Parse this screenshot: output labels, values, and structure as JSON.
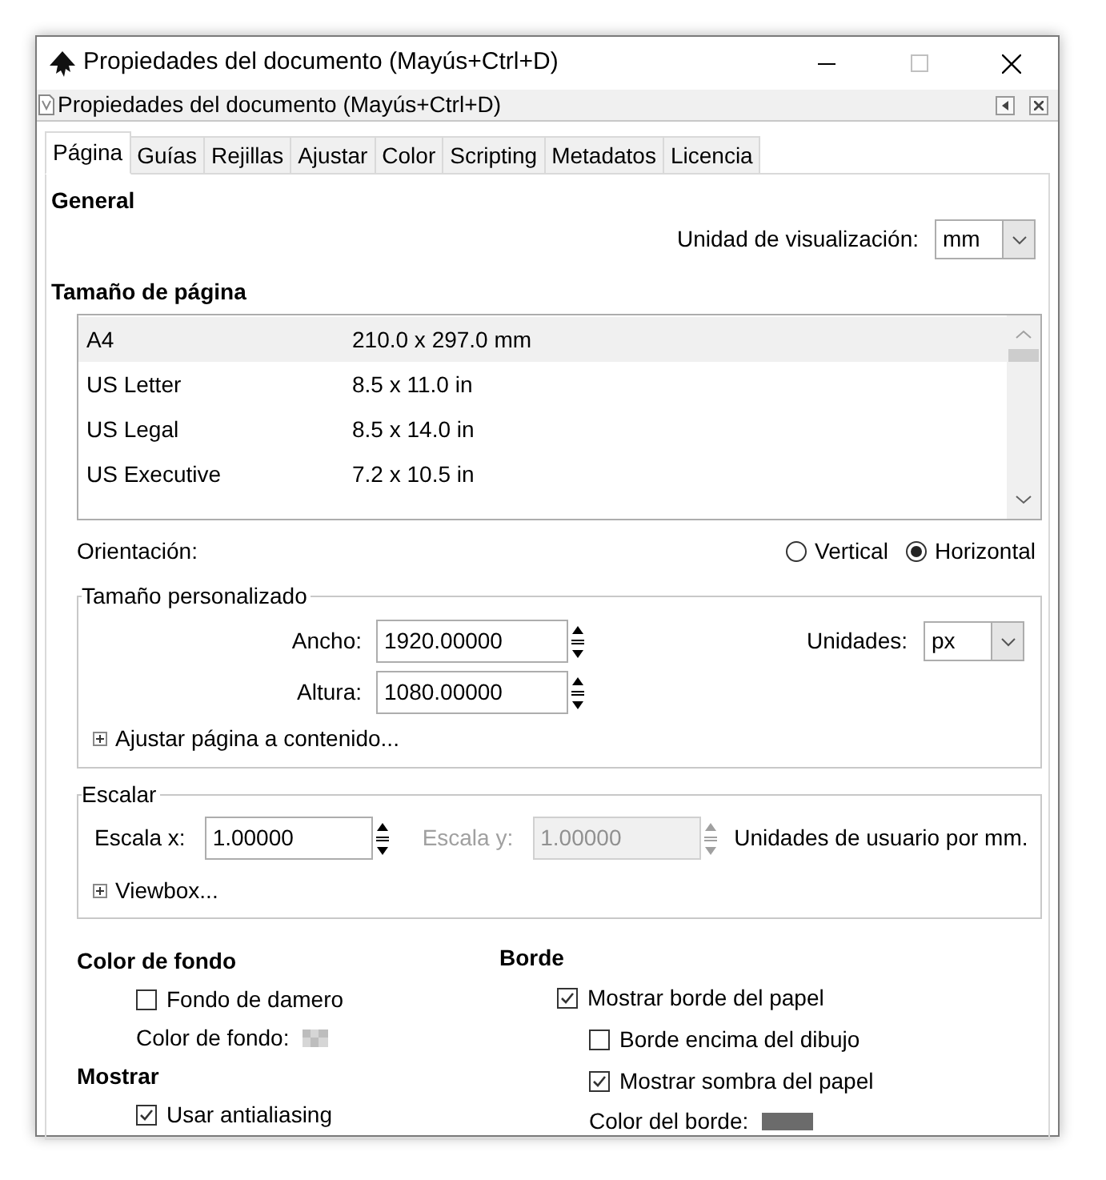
{
  "window": {
    "title": "Propiedades del documento (Mayús+Ctrl+D)"
  },
  "panel": {
    "title": "Propiedades del documento (Mayús+Ctrl+D)"
  },
  "tabs": [
    {
      "label": "Página",
      "selected": true
    },
    {
      "label": "Guías",
      "selected": false
    },
    {
      "label": "Rejillas",
      "selected": false
    },
    {
      "label": "Ajustar",
      "selected": false
    },
    {
      "label": "Color",
      "selected": false
    },
    {
      "label": "Scripting",
      "selected": false
    },
    {
      "label": "Metadatos",
      "selected": false
    },
    {
      "label": "Licencia",
      "selected": false
    }
  ],
  "general": {
    "heading": "General",
    "display_unit": {
      "label": "Unidad de visualización:",
      "value": "mm"
    }
  },
  "page_size": {
    "heading": "Tamaño de página",
    "rows": [
      {
        "name": "A4",
        "size": "210.0 x 297.0 mm",
        "selected": true
      },
      {
        "name": "US Letter",
        "size": "8.5 x 11.0 in",
        "selected": false
      },
      {
        "name": "US Legal",
        "size": "8.5 x 14.0 in",
        "selected": false
      },
      {
        "name": "US Executive",
        "size": "7.2 x 10.5 in",
        "selected": false
      }
    ]
  },
  "orientation": {
    "label": "Orientación:",
    "options": [
      {
        "label": "Vertical",
        "selected": false
      },
      {
        "label": "Horizontal",
        "selected": true
      }
    ]
  },
  "custom_size": {
    "legend": "Tamaño personalizado",
    "width": {
      "label": "Ancho:",
      "value": "1920.00000"
    },
    "height": {
      "label": "Altura:",
      "value": "1080.00000"
    },
    "units": {
      "label": "Unidades:",
      "value": "px"
    },
    "expander": {
      "label": "Ajustar página a contenido...",
      "expanded": false
    }
  },
  "scale": {
    "legend": "Escalar",
    "scale_x": {
      "label": "Escala x:",
      "value": "1.00000",
      "disabled": false
    },
    "scale_y": {
      "label": "Escala y:",
      "value": "1.00000",
      "disabled": true
    },
    "note": "Unidades de usuario por mm.",
    "expander": {
      "label": "Viewbox...",
      "expanded": false
    }
  },
  "background": {
    "heading": "Color de fondo",
    "checkerboard": {
      "label": "Fondo de damero",
      "checked": false
    },
    "color_label": "Color de fondo:"
  },
  "display": {
    "heading": "Mostrar",
    "antialiasing": {
      "label": "Usar antialiasing",
      "checked": true
    }
  },
  "border": {
    "heading": "Borde",
    "items": [
      {
        "label": "Mostrar borde del papel",
        "checked": true,
        "children": [
          {
            "label": "Borde encima del dibujo",
            "checked": false
          },
          {
            "label": "Mostrar sombra del papel",
            "checked": true
          }
        ]
      }
    ],
    "color_label": "Color del borde:"
  }
}
